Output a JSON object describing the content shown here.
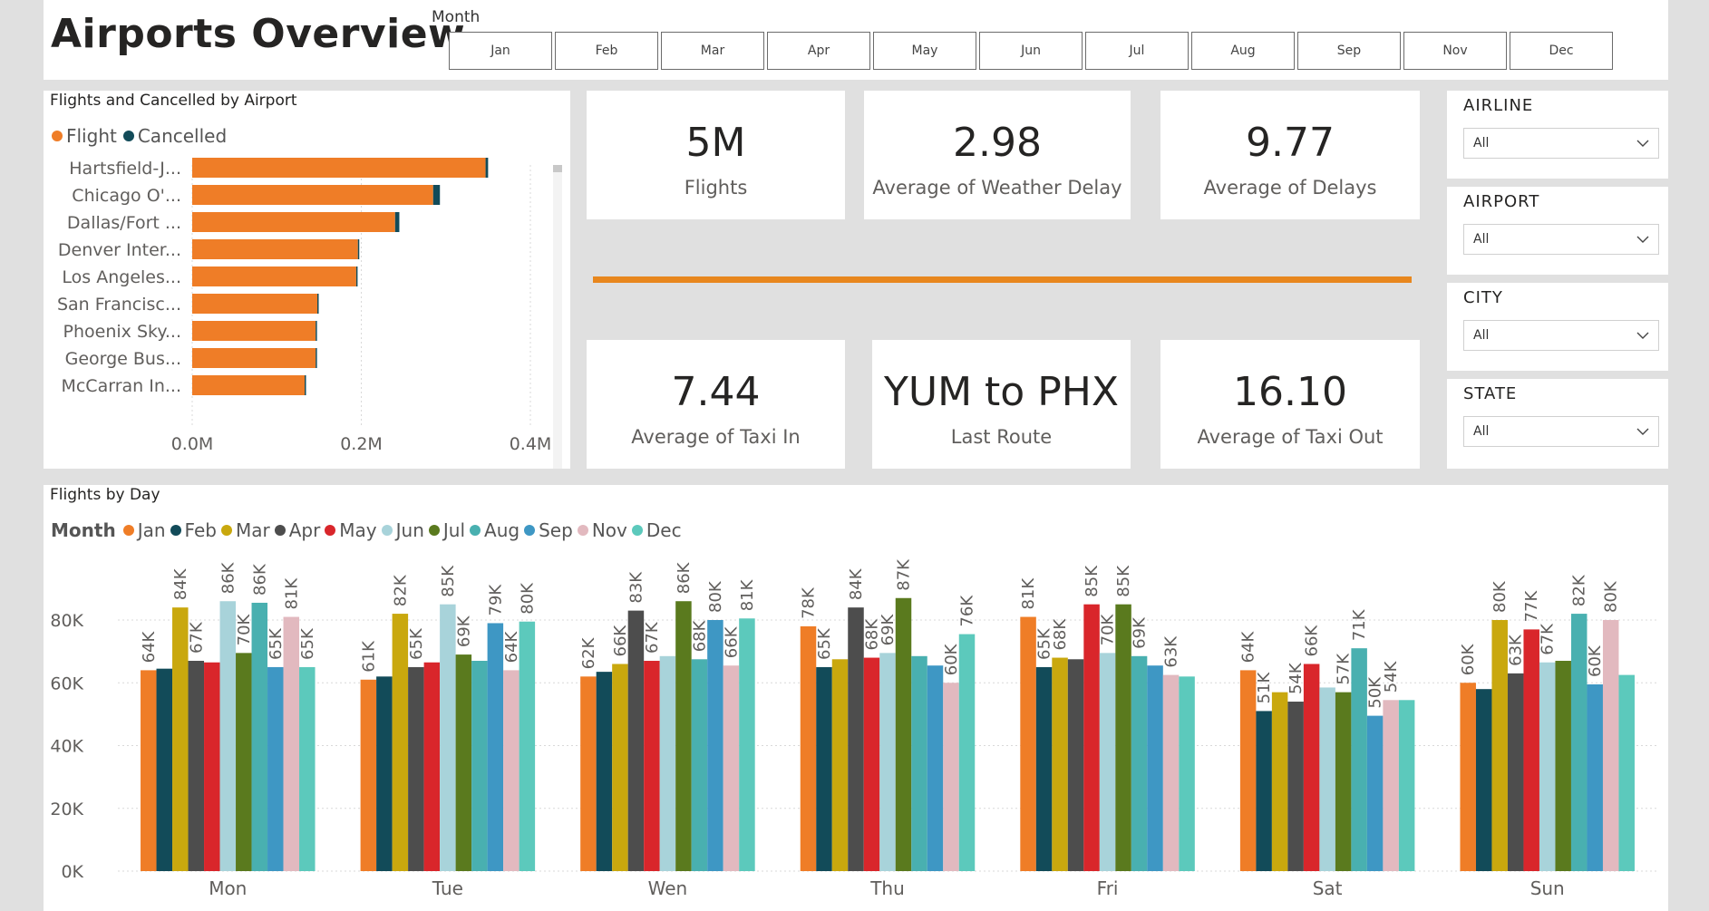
{
  "header": {
    "title": "Airports Overview",
    "month_label": "Month",
    "months": [
      "Jan",
      "Feb",
      "Mar",
      "Apr",
      "May",
      "Jun",
      "Jul",
      "Aug",
      "Sep",
      "Nov",
      "Dec"
    ]
  },
  "kpis": [
    {
      "value": "5M",
      "label": "Flights"
    },
    {
      "value": "2.98",
      "label": "Average of Weather Delay"
    },
    {
      "value": "9.77",
      "label": "Average of Delays"
    },
    {
      "value": "7.44",
      "label": "Average of Taxi In"
    },
    {
      "value": "YUM to PHX",
      "label": "Last Route"
    },
    {
      "value": "16.10",
      "label": "Average of Taxi Out"
    }
  ],
  "filters": [
    {
      "title": "AIRLINE",
      "value": "All"
    },
    {
      "title": "AIRPORT",
      "value": "All"
    },
    {
      "title": "CITY",
      "value": "All"
    },
    {
      "title": "STATE",
      "value": "All"
    }
  ],
  "colors": {
    "accent": "#e8871e",
    "flight": "#ef7d27",
    "cancelled": "#124b59"
  },
  "chart_data": [
    {
      "type": "bar",
      "orientation": "horizontal",
      "title": "Flights and Cancelled by Airport",
      "categories": [
        "Hartsfield-J...",
        "Chicago O'...",
        "Dallas/Fort ...",
        "Denver Inter...",
        "Los Angeles...",
        "San Francisc...",
        "Phoenix Sky...",
        "George Bus...",
        "McCarran In..."
      ],
      "series": [
        {
          "name": "Flight",
          "color": "#ef7d27",
          "values": [
            0.347,
            0.285,
            0.24,
            0.196,
            0.194,
            0.148,
            0.146,
            0.146,
            0.133
          ]
        },
        {
          "name": "Cancelled",
          "color": "#124b59",
          "values": [
            0.003,
            0.008,
            0.005,
            0.001,
            0.001,
            0.001,
            0.001,
            0.001,
            0.001
          ]
        }
      ],
      "xticks": [
        "0.0M",
        "0.2M",
        "0.4M"
      ],
      "xlim": [
        0,
        0.4
      ],
      "stacked": true,
      "legend": "top-left"
    },
    {
      "type": "bar",
      "title": "Flights by Day",
      "legend_title": "Month",
      "legend": "top-left",
      "categories": [
        "Mon",
        "Tue",
        "Wen",
        "Thu",
        "Fri",
        "Sat",
        "Sun"
      ],
      "yticks": [
        "0K",
        "20K",
        "40K",
        "60K",
        "80K"
      ],
      "ylim": [
        0,
        90000
      ],
      "grid": true,
      "series": [
        {
          "name": "Jan",
          "color": "#ef7d27",
          "values": [
            64000,
            61000,
            62000,
            78000,
            81000,
            64000,
            60000
          ],
          "labels": [
            "64K",
            "61K",
            "62K",
            "78K",
            "81K",
            "64K",
            "60K"
          ]
        },
        {
          "name": "Feb",
          "color": "#124b59",
          "values": [
            64500,
            62000,
            63500,
            65000,
            65000,
            51000,
            58000
          ],
          "labels": [
            "",
            "",
            "",
            "65K",
            "65K",
            "51K",
            ""
          ]
        },
        {
          "name": "Mar",
          "color": "#c9a80e",
          "values": [
            84000,
            82000,
            66000,
            67500,
            68000,
            57000,
            80000
          ],
          "labels": [
            "84K",
            "82K",
            "66K",
            "",
            "68K",
            "",
            "80K"
          ]
        },
        {
          "name": "Apr",
          "color": "#4d4d4d",
          "values": [
            67000,
            65000,
            83000,
            84000,
            67500,
            54000,
            63000
          ],
          "labels": [
            "67K",
            "65K",
            "83K",
            "84K",
            "",
            "54K",
            "63K"
          ]
        },
        {
          "name": "May",
          "color": "#d9262b",
          "values": [
            66500,
            66500,
            67000,
            68000,
            85000,
            66000,
            77000
          ],
          "labels": [
            "",
            "",
            "67K",
            "68K",
            "85K",
            "66K",
            "77K"
          ]
        },
        {
          "name": "Jun",
          "color": "#a8d3da",
          "values": [
            86000,
            85000,
            68500,
            69500,
            69500,
            58500,
            66500
          ],
          "labels": [
            "86K",
            "85K",
            "",
            "69K",
            "70K",
            "",
            "67K"
          ]
        },
        {
          "name": "Jul",
          "color": "#5a7a1e",
          "values": [
            69500,
            69000,
            86000,
            87000,
            85000,
            57000,
            67000
          ],
          "labels": [
            "70K",
            "69K",
            "86K",
            "87K",
            "85K",
            "57K",
            ""
          ]
        },
        {
          "name": "Aug",
          "color": "#49b0b0",
          "values": [
            85500,
            67000,
            67500,
            68500,
            68500,
            71000,
            82000
          ],
          "labels": [
            "86K",
            "",
            "68K",
            "",
            "69K",
            "71K",
            "82K"
          ]
        },
        {
          "name": "Sep",
          "color": "#3e97c4",
          "values": [
            65000,
            79000,
            80000,
            65500,
            65500,
            49500,
            59500
          ],
          "labels": [
            "65K",
            "79K",
            "80K",
            "",
            "",
            "50K",
            "60K"
          ]
        },
        {
          "name": "Nov",
          "color": "#e2b9bf",
          "values": [
            81000,
            64000,
            65500,
            60000,
            62500,
            54500,
            80000
          ],
          "labels": [
            "81K",
            "64K",
            "66K",
            "60K",
            "63K",
            "54K",
            "80K"
          ]
        },
        {
          "name": "Dec",
          "color": "#5cc9bc",
          "values": [
            65000,
            79500,
            80500,
            75500,
            62000,
            54500,
            62500
          ],
          "labels": [
            "65K",
            "80K",
            "81K",
            "76K",
            "",
            "",
            ""
          ]
        }
      ]
    }
  ]
}
